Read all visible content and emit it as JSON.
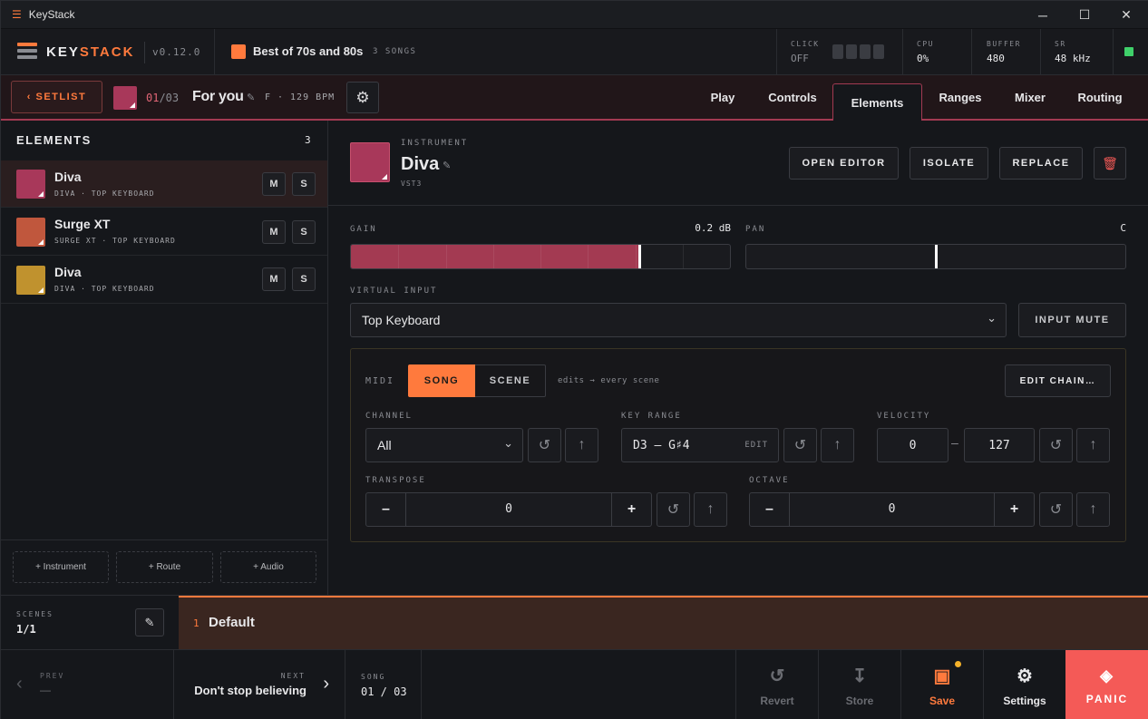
{
  "window": {
    "title": "KeyStack",
    "minimize": "─",
    "maximize": "☐",
    "close": "✕"
  },
  "brand": {
    "key": "KEY",
    "stack": "STACK",
    "version": "v0.12.0"
  },
  "setlist_header": {
    "name": "Best of 70s and 80s",
    "count": "3 SONGS"
  },
  "stats": {
    "click_label": "CLICK",
    "click_value": "OFF",
    "cpu_label": "CPU",
    "cpu_value": "0%",
    "buffer_label": "BUFFER",
    "buffer_value": "480",
    "sr_label": "SR",
    "sr_value": "48 kHz"
  },
  "song": {
    "setlist_button": "‹  SETLIST",
    "index": "01",
    "total": "/03",
    "title": "For you",
    "key": "F",
    "bpm": "· 129 BPM"
  },
  "tabs": [
    {
      "label": "Play"
    },
    {
      "label": "Controls"
    },
    {
      "label": "Elements"
    },
    {
      "label": "Ranges"
    },
    {
      "label": "Mixer"
    },
    {
      "label": "Routing"
    }
  ],
  "sidebar": {
    "title": "ELEMENTS",
    "count": "3",
    "items": [
      {
        "name": "Diva",
        "sub": "DIVA · TOP KEYBOARD",
        "color": "#a8385a",
        "m": "M",
        "s": "S"
      },
      {
        "name": "Surge XT",
        "sub": "SURGE XT · TOP KEYBOARD",
        "color": "#c0573d",
        "m": "M",
        "s": "S"
      },
      {
        "name": "Diva",
        "sub": "DIVA · TOP KEYBOARD",
        "color": "#c0922e",
        "m": "M",
        "s": "S"
      }
    ],
    "add_instrument": "+ Instrument",
    "add_route": "+ Route",
    "add_audio": "+ Audio"
  },
  "instrument": {
    "kind": "INSTRUMENT",
    "name": "Diva",
    "format": "VST3",
    "color": "#a8385a",
    "open_editor": "OPEN EDITOR",
    "isolate": "ISOLATE",
    "replace": "REPLACE"
  },
  "gain": {
    "label": "GAIN",
    "value": "0.2 dB",
    "fill_fraction": 0.76
  },
  "pan": {
    "label": "PAN",
    "value": "C",
    "position_fraction": 0.5
  },
  "virtual_input": {
    "label": "VIRTUAL INPUT",
    "value": "Top Keyboard",
    "mute": "INPUT MUTE"
  },
  "midi": {
    "label": "MIDI",
    "song": "SONG",
    "scene": "SCENE",
    "hint": "edits → every scene",
    "edit_chain": "EDIT CHAIN…",
    "channel_label": "CHANNEL",
    "channel_value": "All",
    "key_range_label": "KEY RANGE",
    "key_range_value": "D3 – G♯4",
    "key_range_edit": "EDIT",
    "velocity_label": "VELOCITY",
    "velocity_min": "0",
    "velocity_dash": "–",
    "velocity_max": "127",
    "transpose_label": "TRANSPOSE",
    "transpose_value": "0",
    "octave_label": "OCTAVE",
    "octave_value": "0",
    "minus": "–",
    "plus": "+"
  },
  "scenes": {
    "label": "SCENES",
    "value": "1/1",
    "current_index": "1",
    "current_name": "Default"
  },
  "footer": {
    "prev_label": "PREV",
    "prev_value": "—",
    "next_label": "NEXT",
    "next_value": "Don't stop believing",
    "song_label": "SONG",
    "song_value": "01 / 03",
    "revert": "Revert",
    "store": "Store",
    "save": "Save",
    "settings": "Settings",
    "panic": "PANIC"
  },
  "colors": {
    "accent": "#ff7a3d",
    "crimson": "#a33a52",
    "panic": "#f45a57",
    "ok": "#3fd06a"
  }
}
